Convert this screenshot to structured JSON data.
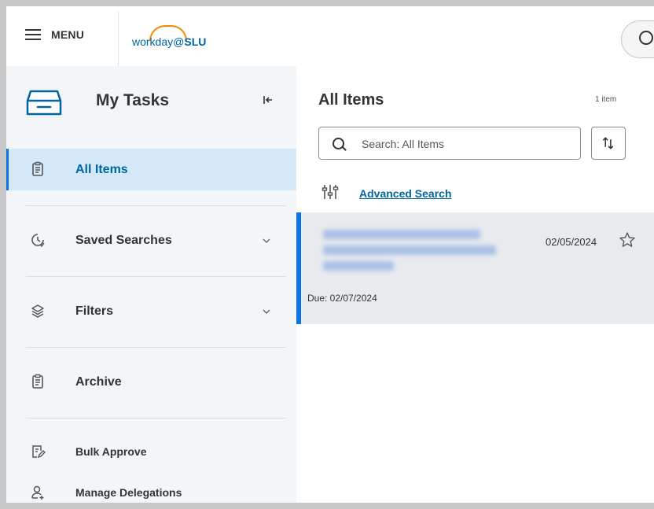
{
  "header": {
    "menu_label": "MENU",
    "logo_word": "workday",
    "logo_at": "@",
    "logo_org": "SLU"
  },
  "sidebar": {
    "title": "My Tasks",
    "items": [
      {
        "label": "All Items",
        "icon": "clipboard-icon",
        "active": true
      },
      {
        "label": "Saved Searches",
        "icon": "clock-icon",
        "expandable": true
      },
      {
        "label": "Filters",
        "icon": "layers-icon",
        "expandable": true
      },
      {
        "label": "Archive",
        "icon": "clipboard-icon"
      },
      {
        "label": "Bulk Approve",
        "icon": "edit-document-icon"
      },
      {
        "label": "Manage Delegations",
        "icon": "user-add-icon"
      }
    ]
  },
  "main": {
    "title": "All Items",
    "count": "1 item",
    "search_placeholder": "Search: All Items",
    "advanced_search": "Advanced Search",
    "task": {
      "date": "02/05/2024",
      "due": "Due: 02/07/2024"
    }
  },
  "colors": {
    "accent": "#0875e1",
    "link": "#0065a3",
    "active_bg": "#d5e8f7",
    "sidebar_bg": "#f3f6f8",
    "logo_arc": "#f38b00"
  }
}
